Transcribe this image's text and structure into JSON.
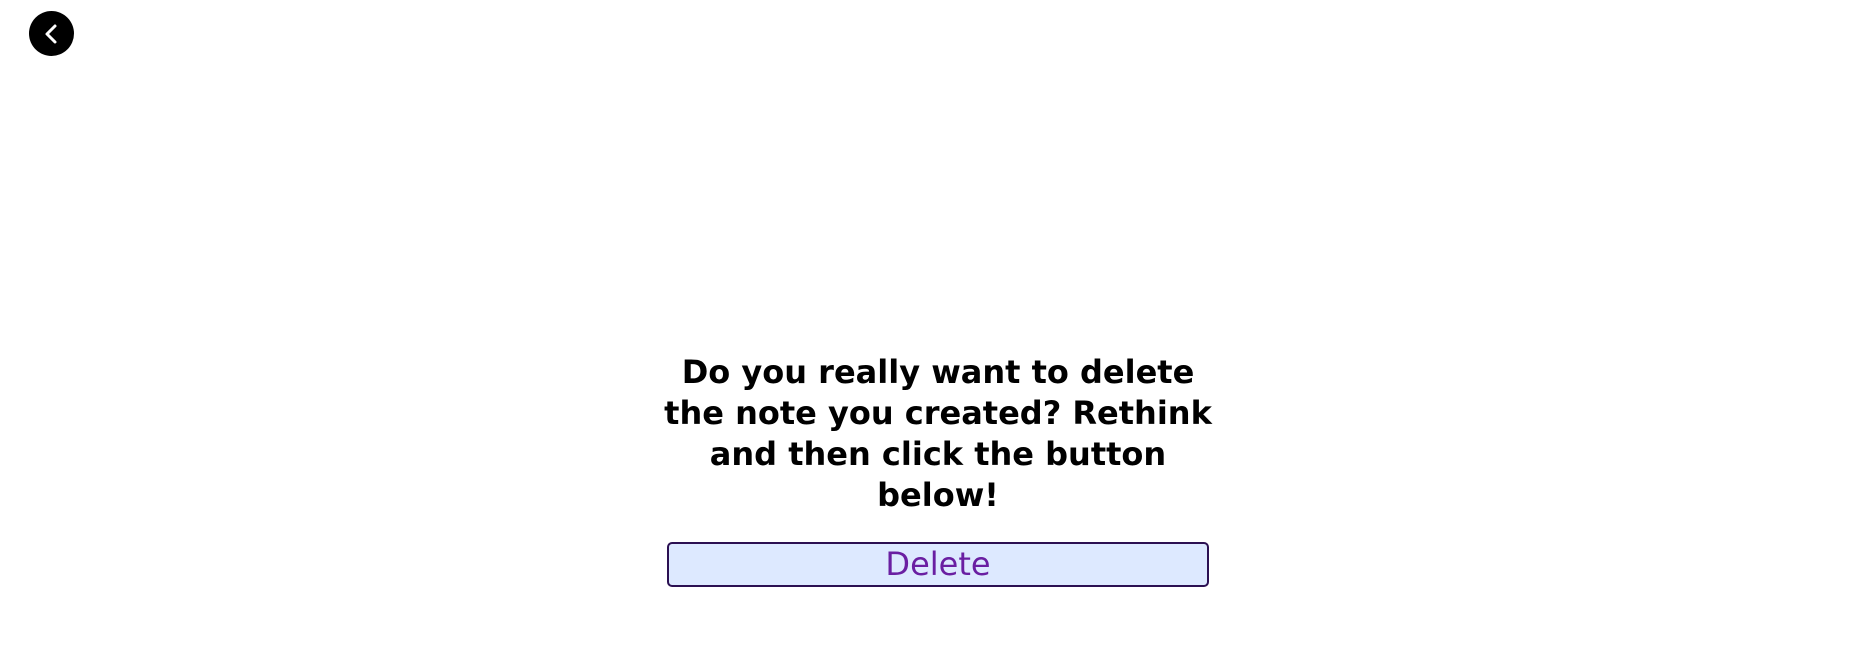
{
  "header": {
    "back_icon": "chevron-left-icon"
  },
  "dialog": {
    "message": "Do you really want to delete the note you created? Rethink and then click the button below!",
    "delete_label": "Delete"
  },
  "colors": {
    "back_button_bg": "#000000",
    "delete_button_bg": "#dde9ff",
    "delete_button_border": "#2b1052",
    "delete_button_text": "#6a1fa2"
  }
}
